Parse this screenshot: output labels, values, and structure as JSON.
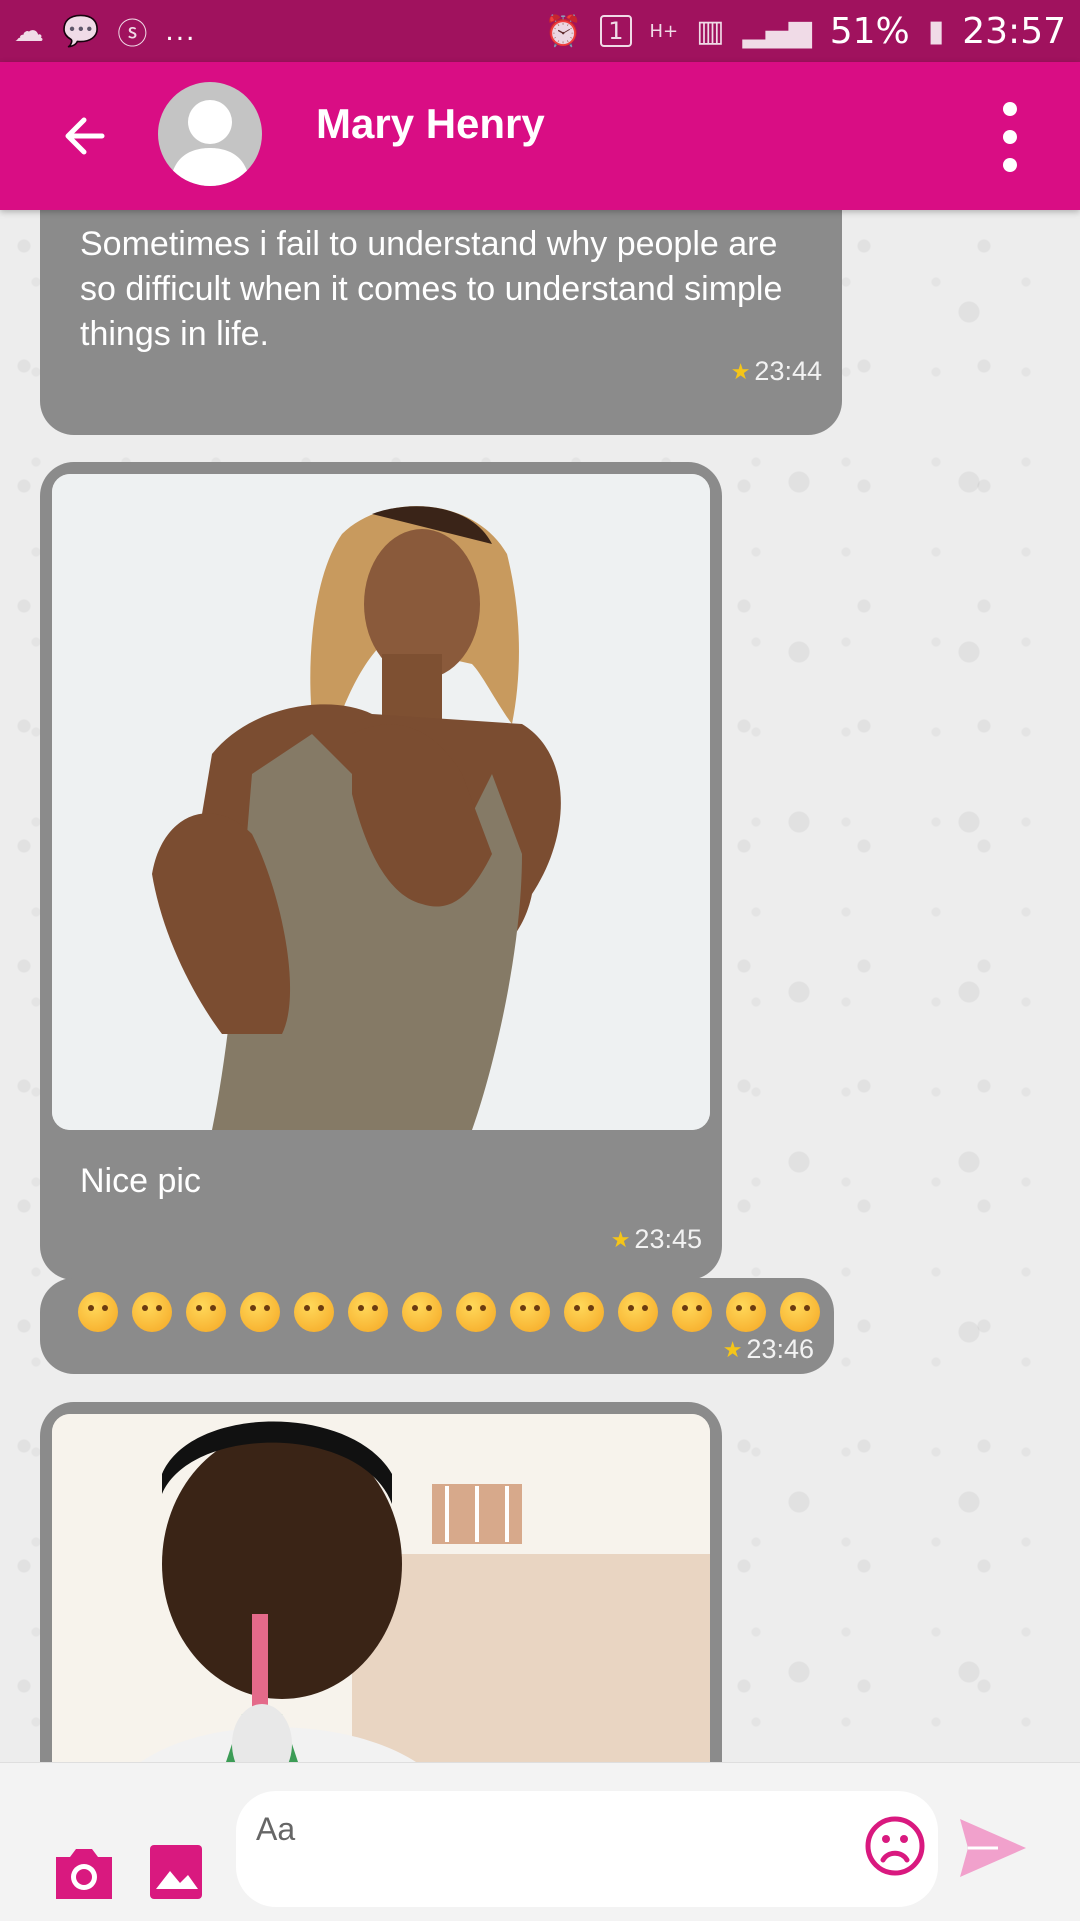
{
  "status_bar": {
    "battery": "51%",
    "time": "23:57",
    "network": "H+",
    "notification_count": "1",
    "overflow": "..."
  },
  "header": {
    "contact_name": "Mary Henry"
  },
  "messages": [
    {
      "text": "Sometimes i fail to understand why people are so difficult when it comes to understand simple things in life.",
      "time": "23:44"
    },
    {
      "caption": "Nice pic",
      "time": "23:45"
    },
    {
      "emojis": [
        "😲",
        "😥",
        "😯",
        "😭",
        "😣",
        "😥",
        "😪",
        "😜",
        "😔",
        "😁",
        "😰",
        "😔",
        "😪",
        "😝"
      ],
      "time": "23:46"
    }
  ],
  "composer": {
    "placeholder": "Aa"
  },
  "colors": {
    "status_bar": "#a0125e",
    "app_bar": "#d90d84",
    "bubble": "#8b8b8b",
    "accent": "#d9197f",
    "star": "#f5c518"
  }
}
